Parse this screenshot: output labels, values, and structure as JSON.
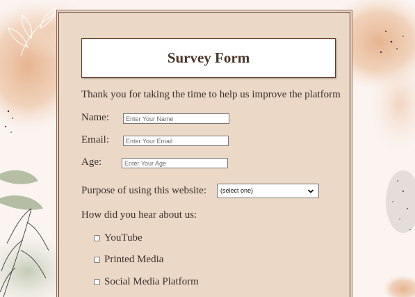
{
  "form": {
    "title": "Survey Form",
    "intro": "Thank you for taking the time to help us improve the platform",
    "fields": {
      "name": {
        "label": "Name:",
        "placeholder": "Enter Your Name",
        "value": ""
      },
      "email": {
        "label": "Email:",
        "placeholder": "Enter Your Email",
        "value": ""
      },
      "age": {
        "label": "Age:",
        "placeholder": "Enter Your Age",
        "value": ""
      }
    },
    "purpose": {
      "label": "Purpose of using this website:",
      "selected": "(select one)"
    },
    "heard_about": {
      "label": "How did you hear about us:",
      "options": [
        "YouTube",
        "Printed Media",
        "Social Media Platform"
      ]
    }
  },
  "colors": {
    "page_background": "#fbf4f1",
    "form_background": "#ebd8c6",
    "border": "#5b3a2a",
    "title_text": "#4a3528",
    "watercolor_peach": "#e8b48e",
    "leaf_green": "#a9b597"
  },
  "icons": {
    "select_arrow": "chevron-down-icon"
  }
}
